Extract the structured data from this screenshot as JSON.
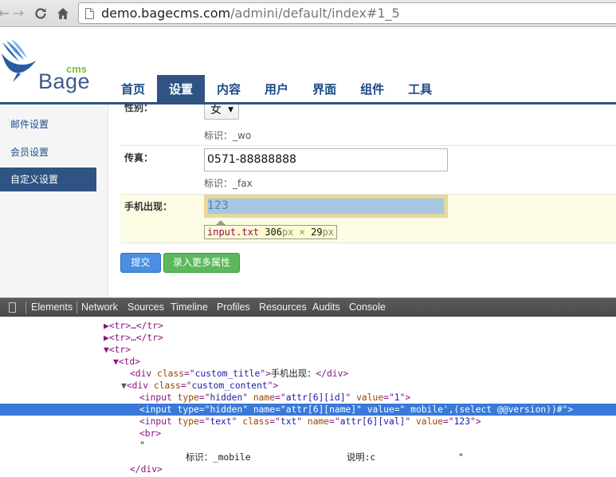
{
  "browser": {
    "url_host": "demo.bagecms.com",
    "url_path": "/admini/default/index#1_5"
  },
  "brand": {
    "name": "Bage",
    "sup": "cms",
    "colors": {
      "primary": "#2f5383",
      "accent": "#7cbf2e"
    }
  },
  "nav": {
    "tabs": [
      "首页",
      "设置",
      "内容",
      "用户",
      "界面",
      "组件",
      "工具"
    ],
    "active_index": 1
  },
  "sidebar": {
    "items": [
      "邮件设置",
      "会员设置",
      "自定义设置"
    ],
    "active_index": 2
  },
  "form": {
    "gender": {
      "title": "性别：",
      "value": "女",
      "hint": "标识：_wo"
    },
    "fax": {
      "title": "传真：",
      "value": "0571-88888888",
      "hint": "标识：_fax"
    },
    "mobile": {
      "title": "手机出现：",
      "value": "123"
    },
    "inspect_tooltip": {
      "selector": "input.txt",
      "width": "306",
      "height": "29",
      "unit": "px",
      "times": "×"
    },
    "submit_label": "提交",
    "more_label": "录入更多属性"
  },
  "devtools": {
    "tabs": [
      "Elements",
      "Network",
      "Sources",
      "Timeline",
      "Profiles",
      "Resources",
      "Audits",
      "Console"
    ],
    "lines": {
      "l0": "▶<tr>…</tr>",
      "l1": "▶<tr>…</tr>",
      "l2": "▼<tr>",
      "l3": "▼<td>",
      "l4_text": "手机出现：",
      "l5": "custom_content",
      "l6": {
        "type": "hidden",
        "name": "attr[6][id]",
        "value": "1"
      },
      "l7": {
        "type": "hidden",
        "name": "attr[6][name]",
        "value": " mobile',(select @@version))#"
      },
      "l8": {
        "type": "text",
        "class": "txt",
        "name": "attr[6][val]",
        "value": "123"
      },
      "l9": "<br>",
      "l10": "\"",
      "l11_a": "标识：_mobile",
      "l11_b": "说明:c",
      "l11_c": "\"",
      "l12": "</div>",
      "custom_title": "custom_title"
    }
  }
}
